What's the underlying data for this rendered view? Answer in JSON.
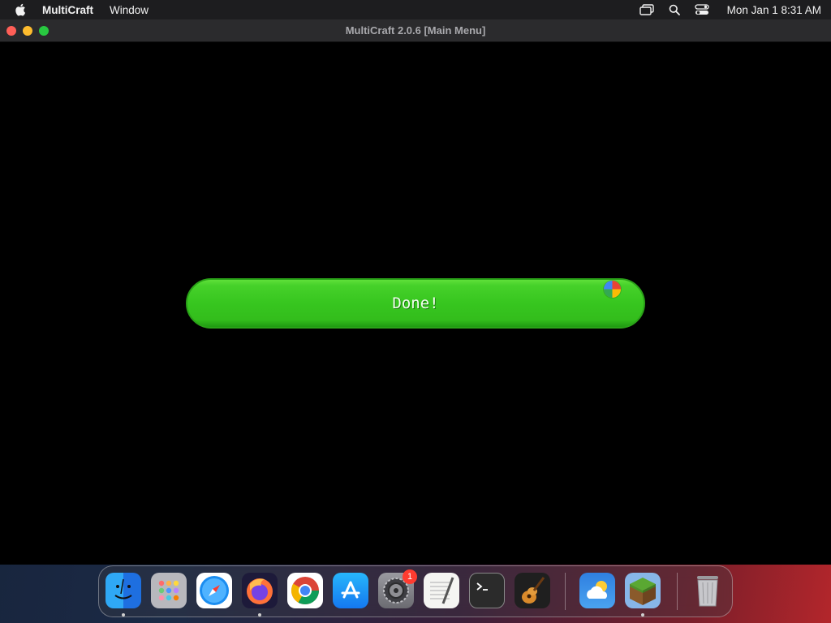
{
  "menubar": {
    "app_name": "MultiCraft",
    "menus": [
      "Window"
    ],
    "clock": "Mon Jan 1  8:31 AM",
    "icons": [
      "apple-icon",
      "screen-mirroring-icon",
      "spotlight-search-icon",
      "control-center-icon"
    ]
  },
  "window": {
    "title": "MultiCraft 2.0.6 [Main Menu]",
    "button_label": "Done!"
  },
  "dock": {
    "items": [
      "Finder",
      "Launchpad",
      "Safari",
      "Firefox",
      "Chrome",
      "App Store",
      "System Settings",
      "TextEdit",
      "Terminal",
      "GarageBand",
      "Weather",
      "MultiCraft",
      "Trash"
    ],
    "badge_system_settings": "1"
  },
  "colors": {
    "accent_green": "#37c61f",
    "close": "#ff5f57",
    "minimize": "#febc2e",
    "maximize": "#28c840"
  }
}
